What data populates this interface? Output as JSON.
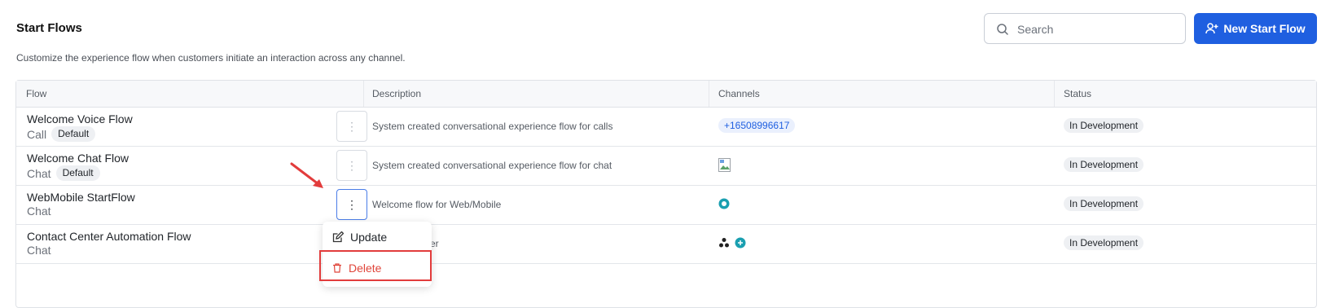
{
  "header": {
    "title": "Start Flows",
    "subtitle": "Customize the experience flow when customers initiate an interaction across any channel.",
    "search_placeholder": "Search",
    "new_button_label": "New Start Flow"
  },
  "table": {
    "columns": [
      "Flow",
      "Description",
      "Channels",
      "Status"
    ],
    "rows": [
      {
        "name": "Welcome Voice Flow",
        "type": "Call",
        "badge": "Default",
        "description": "System created conversational experience flow for calls",
        "channel": "+16508996617",
        "status": "In Development"
      },
      {
        "name": "Welcome Chat Flow",
        "type": "Chat",
        "badge": "Default",
        "description": "System created conversational experience flow for chat",
        "channel": "",
        "status": "In Development"
      },
      {
        "name": "WebMobile StartFlow",
        "type": "Chat",
        "badge": "",
        "description": "Welcome flow for Web/Mobile",
        "channel": "",
        "status": "In Development"
      },
      {
        "name": "Contact Center Automation Flow",
        "type": "Chat",
        "badge": "",
        "description": "er",
        "channel": "",
        "status": "In Development"
      }
    ]
  },
  "menu": {
    "update_label": "Update",
    "delete_label": "Delete"
  },
  "colors": {
    "primary": "#1f5fe0",
    "danger": "#e0453a",
    "highlight": "#e23c3c"
  }
}
